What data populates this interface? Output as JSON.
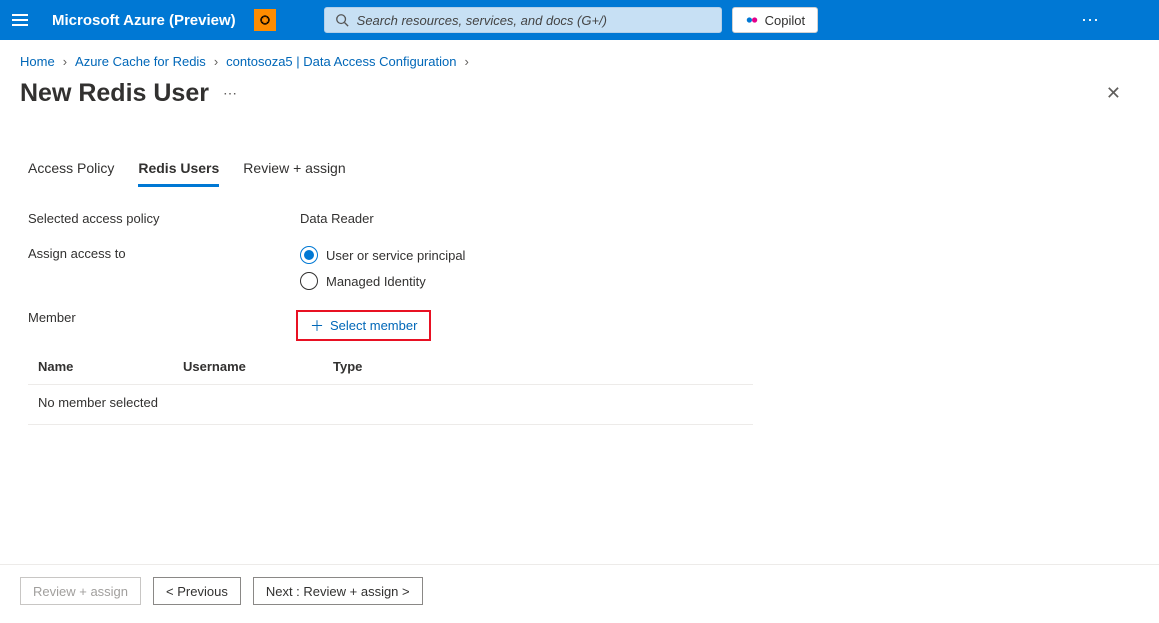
{
  "header": {
    "brand": "Microsoft Azure (Preview)",
    "search_placeholder": "Search resources, services, and docs (G+/)",
    "copilot_label": "Copilot"
  },
  "breadcrumb": {
    "items": [
      "Home",
      "Azure Cache for Redis",
      "contosoza5 | Data Access Configuration"
    ]
  },
  "page": {
    "title": "New Redis User"
  },
  "tabs": [
    {
      "label": "Access Policy",
      "active": false
    },
    {
      "label": "Redis Users",
      "active": true
    },
    {
      "label": "Review + assign",
      "active": false
    }
  ],
  "form": {
    "selected_policy_label": "Selected access policy",
    "selected_policy_value": "Data Reader",
    "assign_label": "Assign access to",
    "radio_user_label": "User or service principal",
    "radio_managed_label": "Managed Identity",
    "member_label": "Member",
    "select_member_label": "Select member"
  },
  "member_table": {
    "columns": {
      "name": "Name",
      "username": "Username",
      "type": "Type"
    },
    "empty_text": "No member selected"
  },
  "footer": {
    "review_assign": "Review + assign",
    "previous": "< Previous",
    "next": "Next : Review + assign >"
  }
}
